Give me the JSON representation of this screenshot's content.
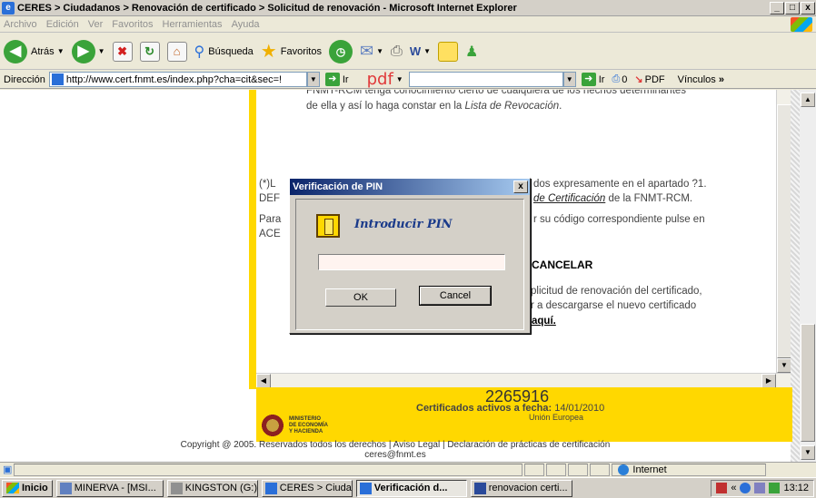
{
  "window": {
    "title": "CERES > Ciudadanos > Renovación de certificado > Solicitud de renovación - Microsoft Internet Explorer",
    "min": "_",
    "max": "□",
    "close": "x"
  },
  "menu": [
    "Archivo",
    "Edición",
    "Ver",
    "Favoritos",
    "Herramientas",
    "Ayuda"
  ],
  "toolbar": {
    "back": "Atrás",
    "search": "Búsqueda",
    "favorites": "Favoritos"
  },
  "address": {
    "label": "Dirección",
    "url": "http://www.cert.fnmt.es/index.php?cha=cit&sec=!",
    "go": "Ir",
    "go2": "Ir",
    "badge_count": "0",
    "pdf_label": "PDF",
    "links": "Vínculos",
    "pdf_logo": "pdf"
  },
  "page": {
    "para1_a": "FNMT-RCM tenga conocimiento cierto de cualquiera de los hechos determinantes",
    "para1_b": "de ella y así lo haga constar en la",
    "para1_italic": "Lista de Revocación",
    "para2_a": "(*)L",
    "para2_b": "dos expresamente en el apartado ?1.",
    "para2_c": "DEF",
    "para2_d": "de Certificación",
    "para2_e": "de la FNMT-RCM.",
    "para3_a": "Para",
    "para3_b": "r su código correspondiente pulse en",
    "para3_c": "ACE",
    "heading_cancel": "CANCELAR",
    "para4_a": "plicitud de renovación del certificado,",
    "para4_b": "r a descargarse el nuevo certificado",
    "link_here": "aquí.",
    "stats_number": "2265916",
    "stats_label": "Certificados activos a fecha:",
    "stats_date": "14/01/2010",
    "stats_sub": "Unión Europea",
    "ministry": [
      "MINISTERIO",
      "DE ECONOMÍA",
      "Y HACIENDA"
    ],
    "copyright": "Copyright @ 2005. Reservados todos los derechos | Aviso Legal | Declaración de prácticas de certificación",
    "email": "ceres@fnmt.es"
  },
  "dialog": {
    "title": "Verificación de PIN",
    "close": "x",
    "heading": "Introducir PIN",
    "pin_value": "",
    "ok": "OK",
    "cancel": "Cancel"
  },
  "status": {
    "zone": "Internet"
  },
  "taskbar": {
    "start": "Inicio",
    "tasks": [
      "MINERVA - [MSI...",
      "KINGSTON (G:)",
      "CERES > Ciuda...",
      "Verificación d...",
      "renovacion certi..."
    ],
    "tray_prefix": "«",
    "time": "13:12"
  }
}
